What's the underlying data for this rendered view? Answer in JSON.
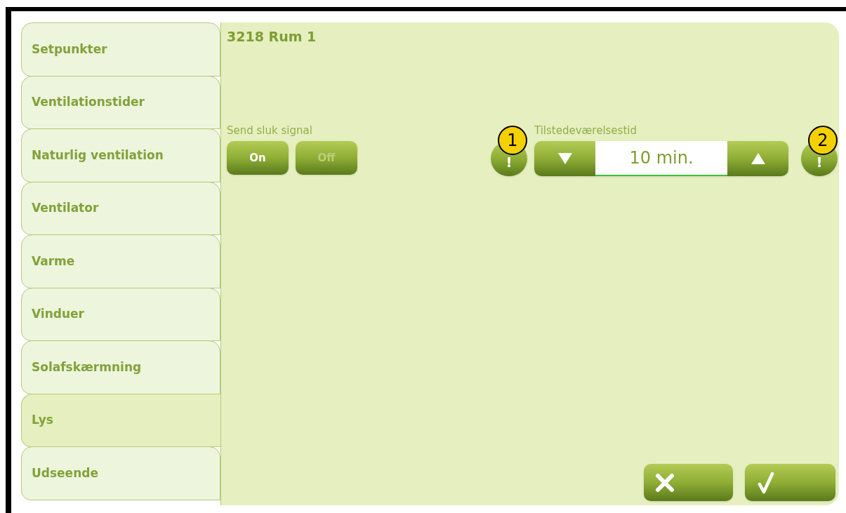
{
  "tabs": [
    {
      "label": "Setpunkter",
      "selected": false
    },
    {
      "label": "Ventilationstider",
      "selected": false
    },
    {
      "label": "Naturlig ventilation",
      "selected": false
    },
    {
      "label": "Ventilator",
      "selected": false
    },
    {
      "label": "Varme",
      "selected": false
    },
    {
      "label": "Vinduer",
      "selected": false
    },
    {
      "label": "Solafskærmning",
      "selected": false
    },
    {
      "label": "Lys",
      "selected": true
    },
    {
      "label": "Udseende",
      "selected": false
    }
  ],
  "title": "3218 Rum 1",
  "send_signal": {
    "label": "Send sluk signal",
    "options": [
      {
        "label": "On",
        "selected": true
      },
      {
        "label": "Off",
        "selected": false
      }
    ]
  },
  "presence_time": {
    "label": "Tilstedeværelsestid",
    "value": "10 min."
  },
  "help_buttons": [
    {
      "label": "!",
      "badge": "1"
    },
    {
      "label": "!",
      "badge": "2"
    }
  ]
}
